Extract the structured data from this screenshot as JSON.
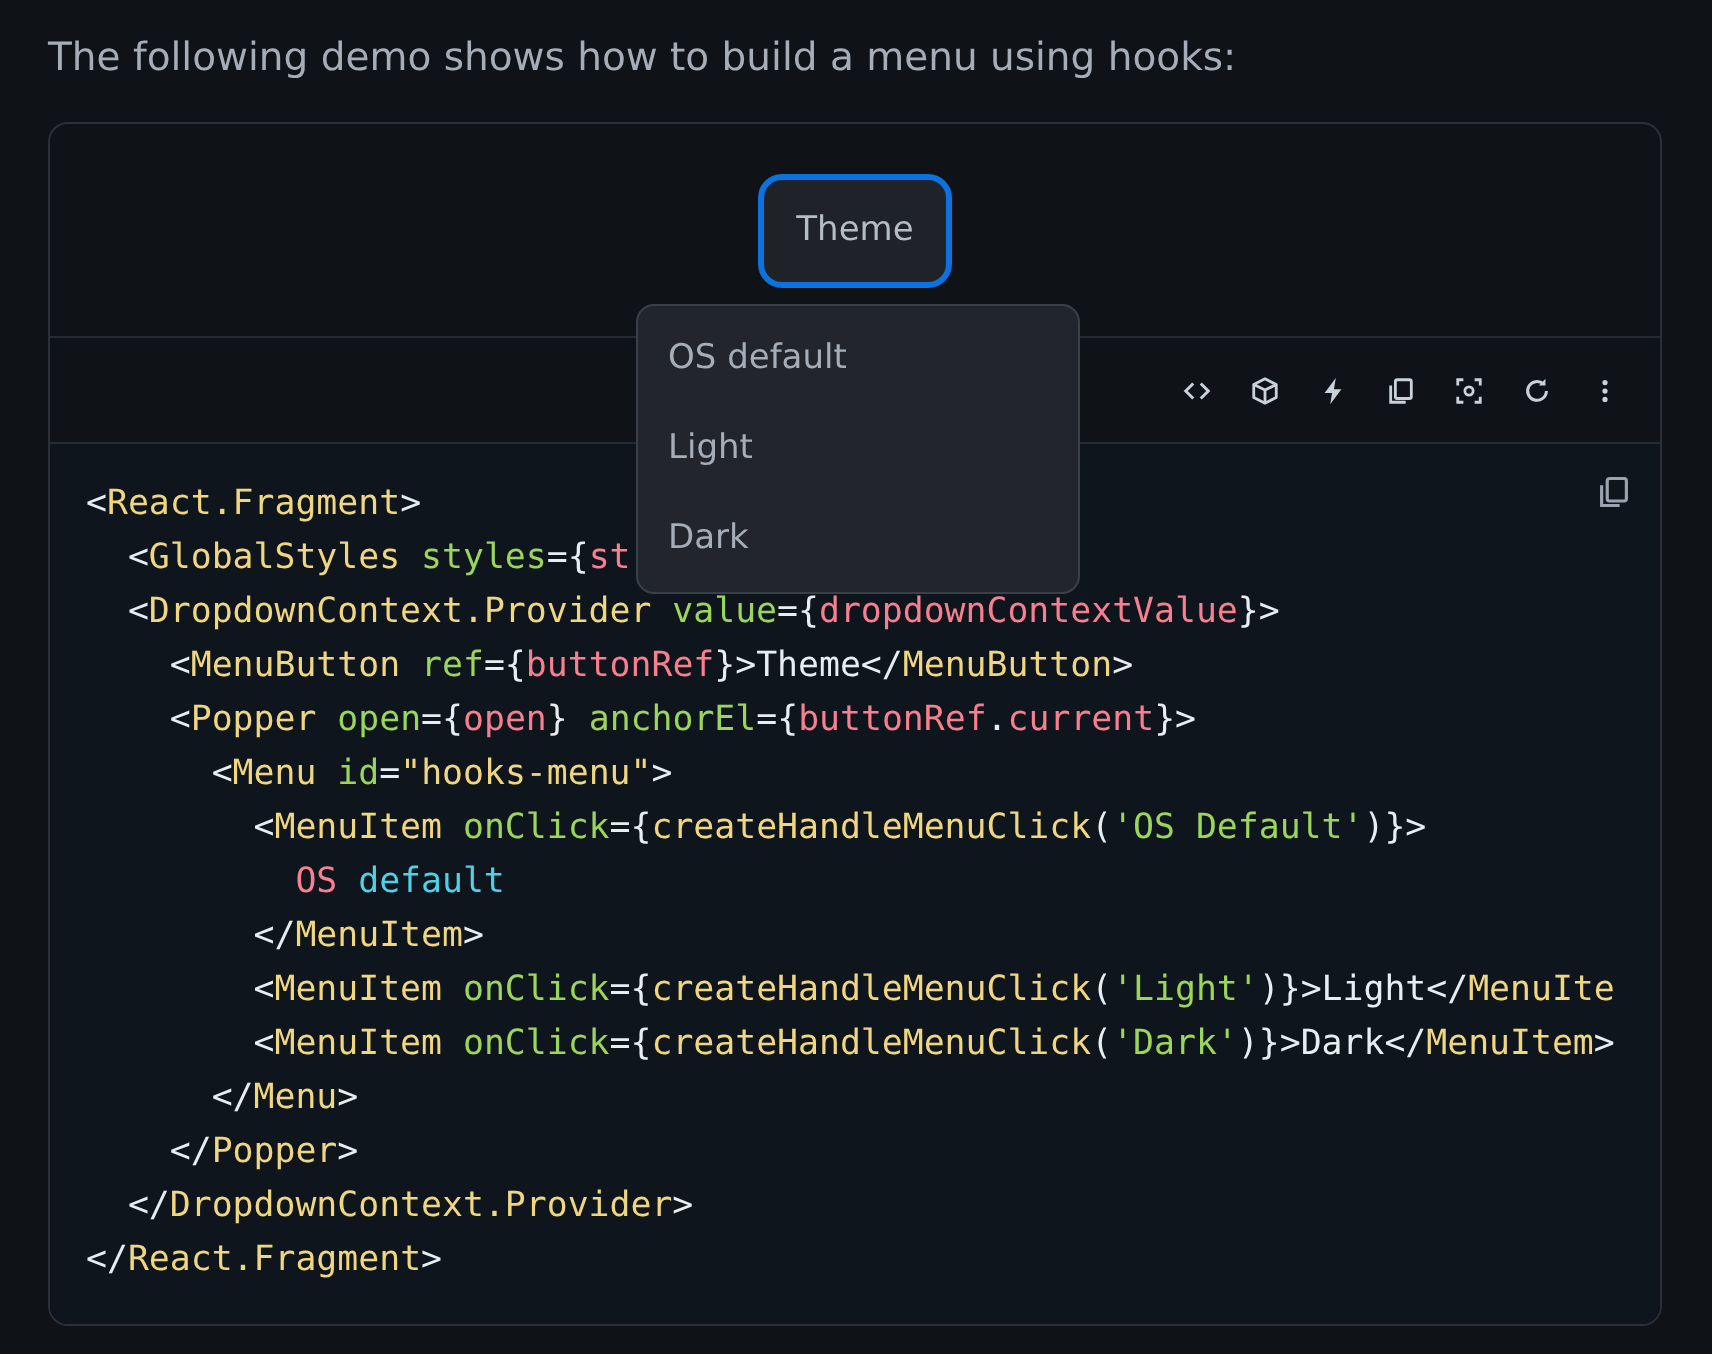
{
  "intro": "The following demo shows how to build a menu using hooks:",
  "demo": {
    "button": {
      "label": "Theme"
    }
  },
  "menu": {
    "items": [
      {
        "label": "OS default"
      },
      {
        "label": "Light"
      },
      {
        "label": "Dark"
      }
    ]
  },
  "code": {
    "lines": [
      [
        {
          "kind": "punct",
          "t": "<"
        },
        {
          "kind": "tag",
          "t": "React.Fragment"
        },
        {
          "kind": "punct",
          "t": ">"
        }
      ],
      [
        {
          "kind": "punct",
          "t": "  <"
        },
        {
          "kind": "tag",
          "t": "GlobalStyles"
        },
        {
          "kind": "attr",
          "t": " styles"
        },
        {
          "kind": "punct",
          "t": "={"
        },
        {
          "kind": "var",
          "t": "st"
        }
      ],
      [
        {
          "kind": "punct",
          "t": "  <"
        },
        {
          "kind": "tag",
          "t": "DropdownContext.Provider"
        },
        {
          "kind": "attr",
          "t": " value"
        },
        {
          "kind": "punct",
          "t": "={"
        },
        {
          "kind": "var",
          "t": "dropdownContextValue"
        },
        {
          "kind": "punct",
          "t": "}>"
        }
      ],
      [
        {
          "kind": "punct",
          "t": "    <"
        },
        {
          "kind": "tag",
          "t": "MenuButton"
        },
        {
          "kind": "attr",
          "t": " ref"
        },
        {
          "kind": "punct",
          "t": "={"
        },
        {
          "kind": "var",
          "t": "buttonRef"
        },
        {
          "kind": "punct",
          "t": "}>Theme</"
        },
        {
          "kind": "tag",
          "t": "MenuButton"
        },
        {
          "kind": "punct",
          "t": ">"
        }
      ],
      [
        {
          "kind": "punct",
          "t": "    <"
        },
        {
          "kind": "tag",
          "t": "Popper"
        },
        {
          "kind": "attr",
          "t": " open"
        },
        {
          "kind": "punct",
          "t": "={"
        },
        {
          "kind": "var",
          "t": "open"
        },
        {
          "kind": "punct",
          "t": "}"
        },
        {
          "kind": "attr",
          "t": " anchorEl"
        },
        {
          "kind": "punct",
          "t": "={"
        },
        {
          "kind": "var",
          "t": "buttonRef"
        },
        {
          "kind": "punct",
          "t": "."
        },
        {
          "kind": "var",
          "t": "current"
        },
        {
          "kind": "punct",
          "t": "}>"
        }
      ],
      [
        {
          "kind": "punct",
          "t": "      <"
        },
        {
          "kind": "tag",
          "t": "Menu"
        },
        {
          "kind": "attr",
          "t": " id"
        },
        {
          "kind": "punct",
          "t": "="
        },
        {
          "kind": "tag",
          "t": "\"hooks-menu\""
        },
        {
          "kind": "punct",
          "t": ">"
        }
      ],
      [
        {
          "kind": "punct",
          "t": "        <"
        },
        {
          "kind": "tag",
          "t": "MenuItem"
        },
        {
          "kind": "attr",
          "t": " onClick"
        },
        {
          "kind": "punct",
          "t": "={"
        },
        {
          "kind": "tag",
          "t": "createHandleMenuClick"
        },
        {
          "kind": "punct",
          "t": "("
        },
        {
          "kind": "str",
          "t": "'OS Default'"
        },
        {
          "kind": "punct",
          "t": ")}>"
        }
      ],
      [
        {
          "kind": "var",
          "t": "          OS"
        },
        {
          "kind": "kw",
          "t": " default"
        }
      ],
      [
        {
          "kind": "punct",
          "t": "        </"
        },
        {
          "kind": "tag",
          "t": "MenuItem"
        },
        {
          "kind": "punct",
          "t": ">"
        }
      ],
      [
        {
          "kind": "punct",
          "t": "        <"
        },
        {
          "kind": "tag",
          "t": "MenuItem"
        },
        {
          "kind": "attr",
          "t": " onClick"
        },
        {
          "kind": "punct",
          "t": "={"
        },
        {
          "kind": "tag",
          "t": "createHandleMenuClick"
        },
        {
          "kind": "punct",
          "t": "("
        },
        {
          "kind": "str",
          "t": "'Light'"
        },
        {
          "kind": "punct",
          "t": ")}>Light</"
        },
        {
          "kind": "tag",
          "t": "MenuIte"
        }
      ],
      [
        {
          "kind": "punct",
          "t": "        <"
        },
        {
          "kind": "tag",
          "t": "MenuItem"
        },
        {
          "kind": "attr",
          "t": " onClick"
        },
        {
          "kind": "punct",
          "t": "={"
        },
        {
          "kind": "tag",
          "t": "createHandleMenuClick"
        },
        {
          "kind": "punct",
          "t": "("
        },
        {
          "kind": "str",
          "t": "'Dark'"
        },
        {
          "kind": "punct",
          "t": ")}>Dark</"
        },
        {
          "kind": "tag",
          "t": "MenuItem"
        },
        {
          "kind": "punct",
          "t": ">"
        }
      ],
      [
        {
          "kind": "punct",
          "t": "      </"
        },
        {
          "kind": "tag",
          "t": "Menu"
        },
        {
          "kind": "punct",
          "t": ">"
        }
      ],
      [
        {
          "kind": "punct",
          "t": "    </"
        },
        {
          "kind": "tag",
          "t": "Popper"
        },
        {
          "kind": "punct",
          "t": ">"
        }
      ],
      [
        {
          "kind": "punct",
          "t": "  </"
        },
        {
          "kind": "tag",
          "t": "DropdownContext.Provider"
        },
        {
          "kind": "punct",
          "t": ">"
        }
      ],
      [
        {
          "kind": "punct",
          "t": "</"
        },
        {
          "kind": "tag",
          "t": "React.Fragment"
        },
        {
          "kind": "punct",
          "t": ">"
        }
      ]
    ]
  }
}
